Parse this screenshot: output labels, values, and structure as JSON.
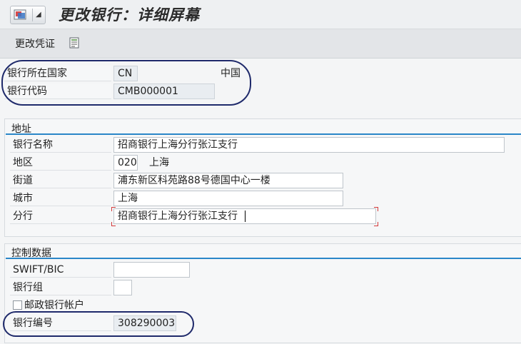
{
  "header": {
    "title": "更改银行：详细屏幕"
  },
  "toolbar": {
    "change_doc_label": "更改凭证"
  },
  "top_fields": {
    "country_label": "银行所在国家",
    "country_value": "CN",
    "country_name": "中国",
    "bank_key_label": "银行代码",
    "bank_key_value": "CMB000001"
  },
  "address": {
    "group_title": "地址",
    "bank_name_label": "银行名称",
    "bank_name_value": "招商银行上海分行张江支行",
    "region_label": "地区",
    "region_code": "020",
    "region_name": "上海",
    "street_label": "街道",
    "street_value": "浦东新区科苑路88号德国中心一楼",
    "city_label": "城市",
    "city_value": "上海",
    "branch_label": "分行",
    "branch_value": "招商银行上海分行张江支行"
  },
  "control": {
    "group_title": "控制数据",
    "swift_label": "SWIFT/BIC",
    "swift_value": "",
    "bank_group_label": "银行组",
    "bank_group_value": "",
    "postal_checkbox_label": "邮政银行帐户",
    "postal_checked": false,
    "bank_number_label": "银行编号",
    "bank_number_value": "308290003"
  },
  "icons": {
    "menu": "sap-menu-icon",
    "menu_arrow": "chevron-down-icon",
    "change_doc": "document-icon"
  },
  "colors": {
    "group_accent": "#2a86c8",
    "highlight_oval": "#1f2a6b",
    "focus_marker": "#d23a3a"
  }
}
